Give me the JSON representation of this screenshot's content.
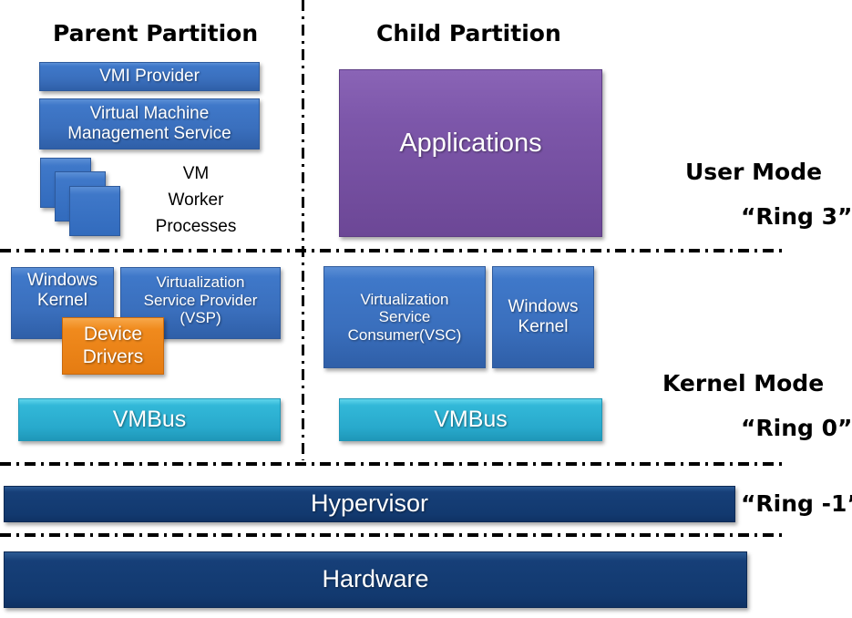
{
  "headings": {
    "parent_partition": "Parent Partition",
    "child_partition": "Child Partition"
  },
  "modes": {
    "user_mode": "User Mode",
    "user_ring": "“Ring 3”",
    "kernel_mode": "Kernel Mode",
    "kernel_ring": "“Ring 0”",
    "hypervisor_ring": "“Ring -1”"
  },
  "parent": {
    "vmi_provider": "VMI Provider",
    "vmms_line1": "Virtual Machine",
    "vmms_line2": "Management Service",
    "vm_worker_line1": "VM",
    "vm_worker_line2": "Worker",
    "vm_worker_line3": "Processes",
    "windows_kernel_line1": "Windows",
    "windows_kernel_line2": "Kernel",
    "vsp_line1": "Virtualization",
    "vsp_line2": "Service Provider",
    "vsp_line3": "(VSP)",
    "device_drivers_line1": "Device",
    "device_drivers_line2": "Drivers",
    "vmbus": "VMBus"
  },
  "child": {
    "applications": "Applications",
    "vsc_line1": "Virtualization",
    "vsc_line2": "Service",
    "vsc_line3": "Consumer(VSC)",
    "windows_kernel_line1": "Windows",
    "windows_kernel_line2": "Kernel",
    "vmbus": "VMBus"
  },
  "hypervisor": "Hypervisor",
  "hardware": "Hardware",
  "colors": {
    "component_blue": "#3f78c9",
    "vmbus_cyan": "#28a9cc",
    "device_drivers_orange": "#f08a1d",
    "applications_purple": "#7d57aa",
    "hypervisor_navy": "#163f78"
  }
}
